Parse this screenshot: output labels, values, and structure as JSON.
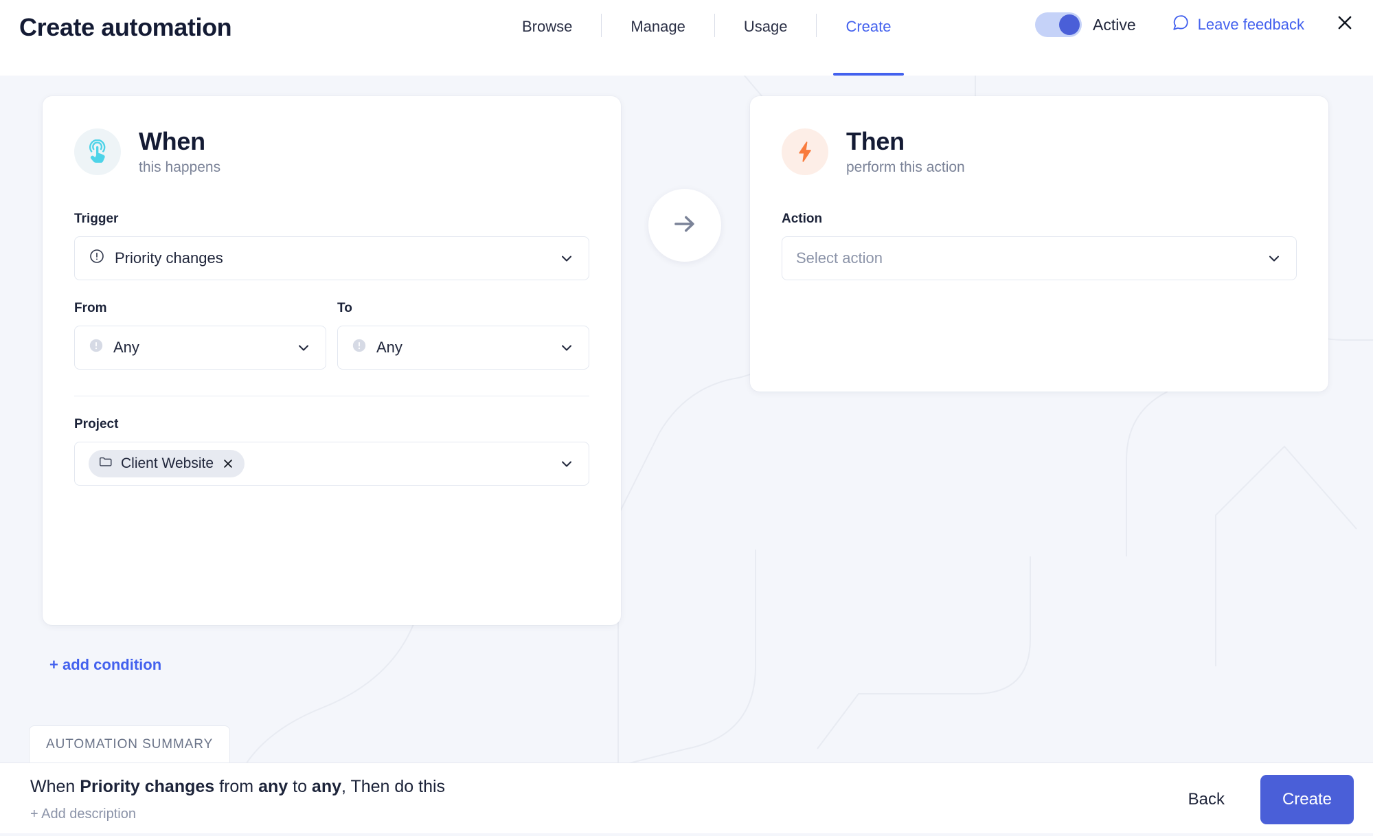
{
  "header": {
    "title": "Create automation",
    "tabs": [
      {
        "label": "Browse",
        "active": false
      },
      {
        "label": "Manage",
        "active": false
      },
      {
        "label": "Usage",
        "active": false
      },
      {
        "label": "Create",
        "active": true
      }
    ],
    "toggle": {
      "label": "Active",
      "state": "on"
    },
    "feedback_label": "Leave feedback",
    "close_icon": "close-icon"
  },
  "when_card": {
    "icon": "tap-gesture-icon",
    "title": "When",
    "subtitle": "this happens",
    "trigger": {
      "label": "Trigger",
      "icon": "alert-circle-icon",
      "value": "Priority changes"
    },
    "from": {
      "label": "From",
      "icon": "priority-any-icon",
      "value": "Any"
    },
    "to": {
      "label": "To",
      "icon": "priority-any-icon",
      "value": "Any"
    },
    "project": {
      "label": "Project",
      "chip_icon": "folder-icon",
      "chip_label": "Client Website",
      "chip_remove_icon": "close-icon"
    }
  },
  "then_card": {
    "icon": "lightning-bolt-icon",
    "title": "Then",
    "subtitle": "perform this action",
    "action": {
      "label": "Action",
      "placeholder": "Select action",
      "value": ""
    }
  },
  "connector_icon": "arrow-right-icon",
  "add_condition_label": "+ add condition",
  "summary": {
    "tab_label": "AUTOMATION SUMMARY",
    "sentence": {
      "part1": "When ",
      "bold1": "Priority changes",
      "part2": " from ",
      "bold2": "any",
      "part3": " to ",
      "bold3": "any",
      "part4": ", Then do this"
    },
    "add_description_label": "+ Add description"
  },
  "footer": {
    "back_label": "Back",
    "create_label": "Create"
  },
  "colors": {
    "accent_blue": "#4361ee",
    "button_blue": "#4a5fd8",
    "canvas_bg": "#f4f6fb",
    "when_icon": "#4ed3e8",
    "then_icon": "#f97b3d",
    "text_dark": "#141b34",
    "text_muted": "#7b8398"
  }
}
